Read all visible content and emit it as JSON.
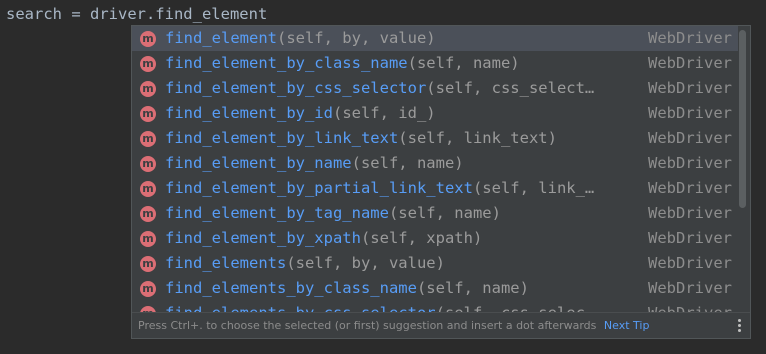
{
  "editor": {
    "line": "search = driver.find_element"
  },
  "popup": {
    "items": [
      {
        "name": "find_element",
        "params": "(self, by, value)",
        "type": "WebDriver",
        "icon": "m"
      },
      {
        "name": "find_element_by_class_name",
        "params": "(self, name)",
        "type": "WebDriver",
        "icon": "m"
      },
      {
        "name": "find_element_by_css_selector",
        "params": "(self, css_select…",
        "type": "WebDriver",
        "icon": "m"
      },
      {
        "name": "find_element_by_id",
        "params": "(self, id_)",
        "type": "WebDriver",
        "icon": "m"
      },
      {
        "name": "find_element_by_link_text",
        "params": "(self, link_text)",
        "type": "WebDriver",
        "icon": "m"
      },
      {
        "name": "find_element_by_name",
        "params": "(self, name)",
        "type": "WebDriver",
        "icon": "m"
      },
      {
        "name": "find_element_by_partial_link_text",
        "params": "(self, link_…",
        "type": "WebDriver",
        "icon": "m"
      },
      {
        "name": "find_element_by_tag_name",
        "params": "(self, name)",
        "type": "WebDriver",
        "icon": "m"
      },
      {
        "name": "find_element_by_xpath",
        "params": "(self, xpath)",
        "type": "WebDriver",
        "icon": "m"
      },
      {
        "name": "find_elements",
        "params": "(self, by, value)",
        "type": "WebDriver",
        "icon": "m"
      },
      {
        "name": "find_elements_by_class_name",
        "params": "(self, name)",
        "type": "WebDriver",
        "icon": "m"
      },
      {
        "name": "find_elements_by_css_selector",
        "params": "(self, css_selec…",
        "type": "WebDriver",
        "icon": "m"
      }
    ],
    "footer_text": "Press Ctrl+. to choose the selected (or first) suggestion and insert a dot afterwards",
    "footer_link": "Next Tip"
  },
  "colors": {
    "background": "#2b2b2b",
    "popup_bg": "#3c3f41",
    "selected_bg": "#4b5059",
    "method_name": "#589df6",
    "params": "#9b9b9b",
    "icon_bg": "#db6e75"
  }
}
